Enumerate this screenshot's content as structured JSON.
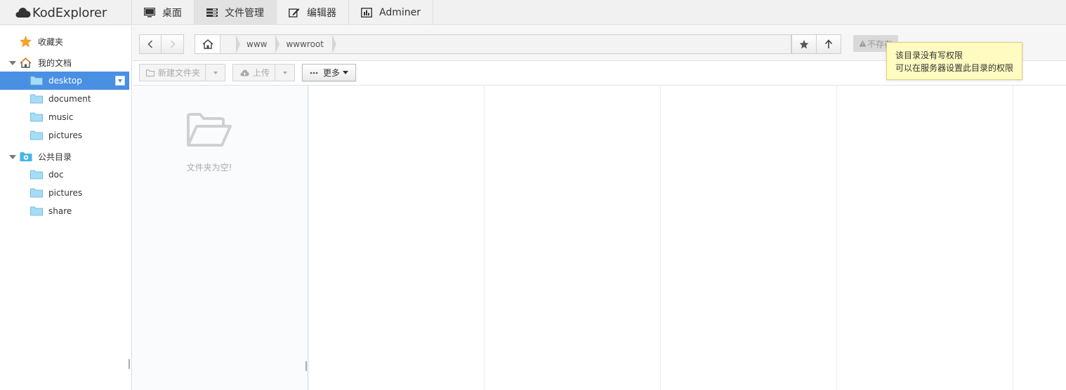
{
  "brand": {
    "name": "KodExplorer"
  },
  "nav": [
    {
      "label": "桌面",
      "icon": "monitor-icon"
    },
    {
      "label": "文件管理",
      "icon": "file-manager-icon",
      "active": true
    },
    {
      "label": "编辑器",
      "icon": "edit-icon"
    },
    {
      "label": "Adminer",
      "icon": "bar-chart-icon"
    }
  ],
  "sidebar": {
    "favorites": "收藏夹",
    "my_docs": "我的文档",
    "my_docs_items": [
      "desktop",
      "document",
      "music",
      "pictures"
    ],
    "public": "公共目录",
    "public_items": [
      "doc",
      "pictures",
      "share"
    ]
  },
  "pathbar": {
    "crumbs": [
      "www",
      "wwwroot"
    ],
    "not_exist": "不存在"
  },
  "toolbar": {
    "new_folder": "新建文件夹",
    "upload": "上传",
    "more": "更多"
  },
  "tooltip": {
    "line1": "该目录没有写权限",
    "line2": "可以在服务器设置此目录的权限"
  },
  "content": {
    "empty_text": "文件夹为空!"
  },
  "colors": {
    "accent": "#4a90e2",
    "folder": "#8ccdf2",
    "tooltip_bg": "#fffbc1"
  }
}
